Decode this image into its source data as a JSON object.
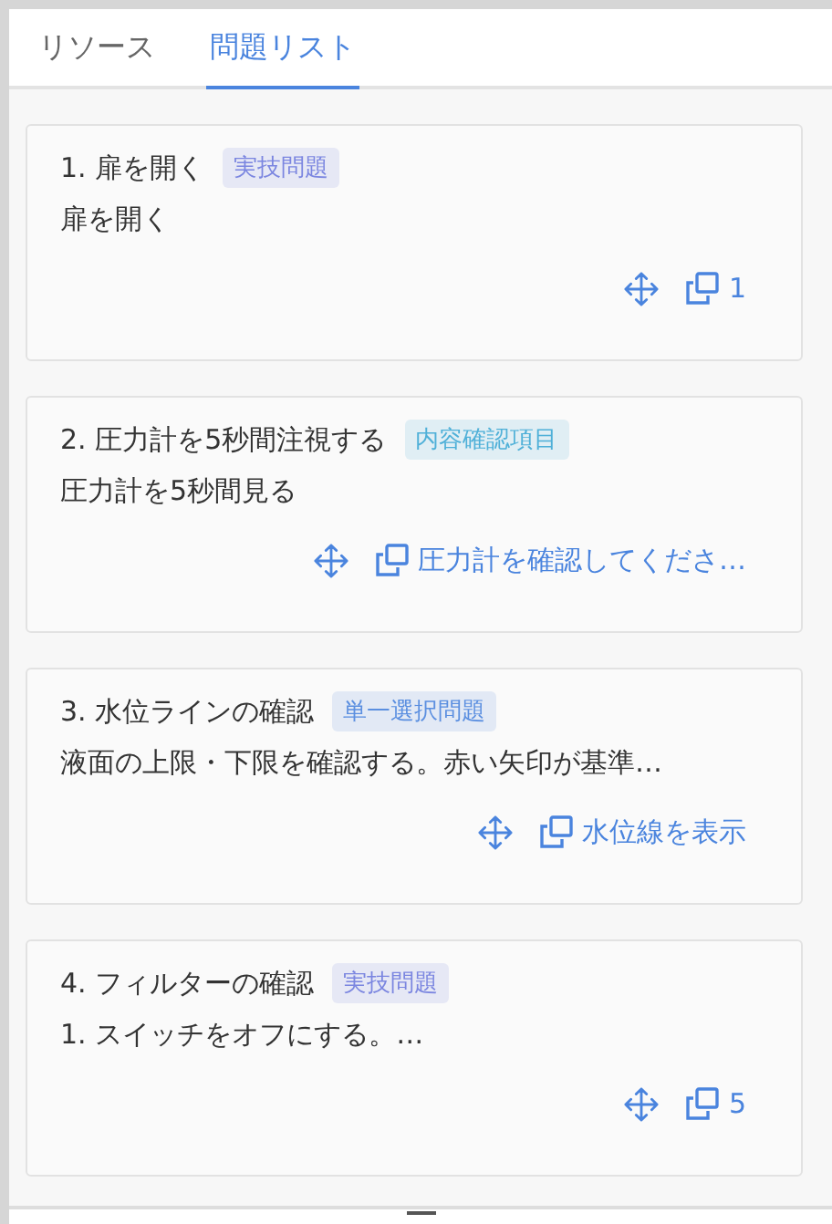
{
  "tabs": [
    {
      "label": "リソース",
      "selected": false
    },
    {
      "label": "問題リスト",
      "selected": true
    }
  ],
  "questions": [
    {
      "title": "1. 扉を開く",
      "tag": {
        "label": "実技問題",
        "color": "#7b86e0"
      },
      "description": "扉を開く",
      "link": "1"
    },
    {
      "title": "2. 圧力計を5秒間注視する",
      "tag": {
        "label": "内容確認項目",
        "color": "#4fb0d8"
      },
      "description": "圧力計を5秒間見る",
      "link": "圧力計を確認してくださ…"
    },
    {
      "title": "3. 水位ラインの確認",
      "tag": {
        "label": "単一選択問題",
        "color": "#5b8fe0"
      },
      "description": "液面の上限・下限を確認する。赤い矢印が基準…",
      "link": "水位線を表示"
    },
    {
      "title": "4. フィルターの確認",
      "tag": {
        "label": "実技問題",
        "color": "#7b86e0"
      },
      "description": "1. スイッチをオフにする。…",
      "link": "5"
    }
  ]
}
